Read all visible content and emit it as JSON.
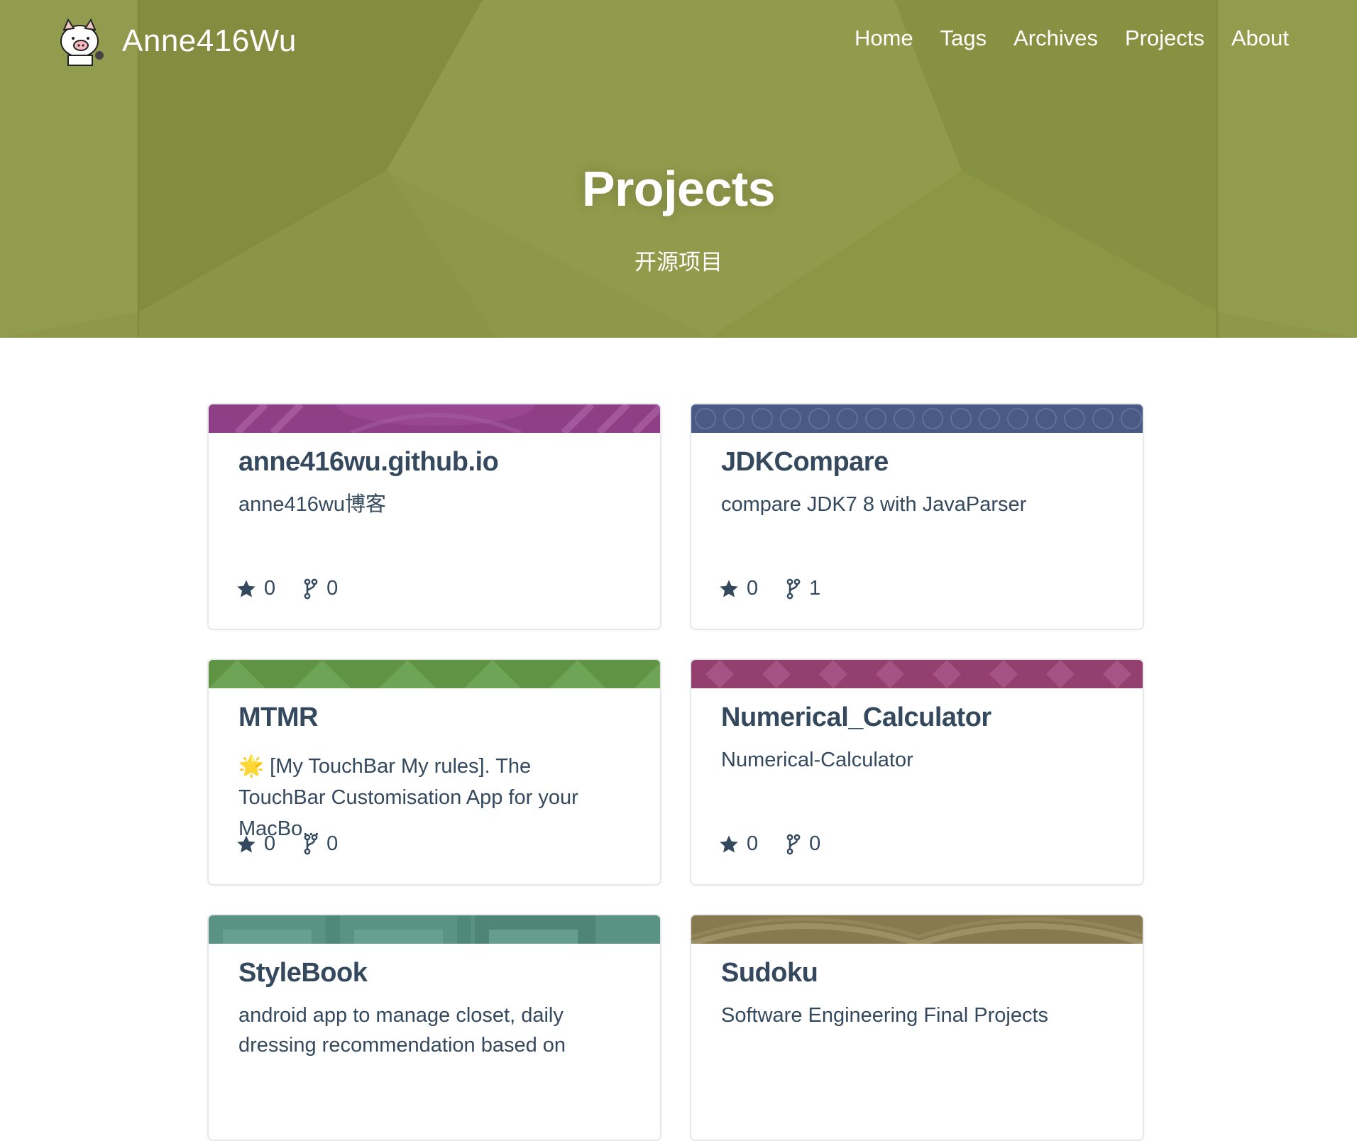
{
  "site": {
    "name": "Anne416Wu"
  },
  "nav": {
    "items": [
      {
        "label": "Home"
      },
      {
        "label": "Tags"
      },
      {
        "label": "Archives"
      },
      {
        "label": "Projects"
      },
      {
        "label": "About"
      }
    ]
  },
  "hero": {
    "title": "Projects",
    "subtitle": "开源项目",
    "bg_color": "#8f9848"
  },
  "icons": {
    "star": "star-icon",
    "fork": "fork-icon",
    "logo": "pig-logo-icon"
  },
  "projects": [
    {
      "name": "anne416wu.github.io",
      "description": "anne416wu博客",
      "stars": "0",
      "forks": "0",
      "banner_color": "#8f3f86"
    },
    {
      "name": "JDKCompare",
      "description": "compare JDK7 8 with JavaParser",
      "stars": "0",
      "forks": "1",
      "banner_color": "#4a5a84"
    },
    {
      "name": "MTMR",
      "description": "🌟 [My TouchBar My rules]. The TouchBar Customisation App for your MacBo...",
      "stars": "0",
      "forks": "0",
      "banner_color": "#5e9444"
    },
    {
      "name": "Numerical_Calculator",
      "description": "Numerical-Calculator",
      "stars": "0",
      "forks": "0",
      "banner_color": "#93406f"
    },
    {
      "name": "StyleBook",
      "description": "android app to manage closet, daily dressing recommendation based on",
      "stars": "",
      "forks": "",
      "banner_color": "#5a9284"
    },
    {
      "name": "Sudoku",
      "description": "Software Engineering Final Projects",
      "stars": "",
      "forks": "",
      "banner_color": "#877a4e"
    }
  ]
}
